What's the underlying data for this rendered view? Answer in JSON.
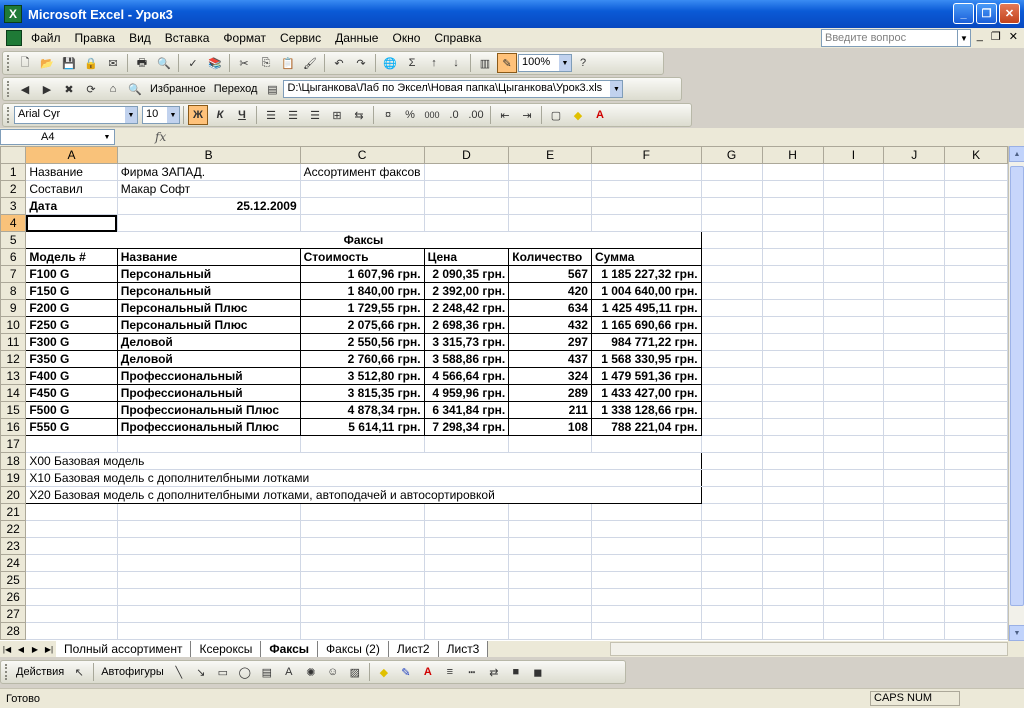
{
  "window": {
    "title": "Microsoft Excel - Урок3",
    "minimize": "_",
    "maximize": "❐",
    "close": "✕"
  },
  "menu": {
    "items": [
      "Файл",
      "Правка",
      "Вид",
      "Вставка",
      "Формат",
      "Сервис",
      "Данные",
      "Окно",
      "Справка"
    ],
    "ask_placeholder": "Введите вопрос",
    "doc_min": "_",
    "doc_restore": "❐",
    "doc_close": "✕"
  },
  "toolbar": {
    "zoom": "100%",
    "favorites_label": "Избранное",
    "goto_label": "Переход",
    "path": "D:\\Цыганкова\\Лаб по Эксел\\Новая папка\\Цыганкова\\Урок3.xls",
    "font_name": "Arial Cyr",
    "font_size": "10",
    "bold_label": "Ж",
    "italic_label": "К",
    "underline_label": "Ч",
    "percent_label": "%",
    "thousands_label": "000"
  },
  "formula_bar": {
    "cell_ref": "A4",
    "fx_label": "fx",
    "content": ""
  },
  "columns": [
    "A",
    "B",
    "C",
    "D",
    "E",
    "F",
    "G",
    "H",
    "I",
    "J",
    "K"
  ],
  "selected_cell": "A4",
  "rows": [
    {
      "n": "1",
      "cells": [
        "Название",
        "Фирма ЗАПАД.",
        "Ассортимент факсов",
        "",
        "",
        ""
      ]
    },
    {
      "n": "2",
      "cells": [
        "Составил",
        "Макар Софт",
        "",
        "",
        "",
        ""
      ]
    },
    {
      "n": "3",
      "cells": [
        "Дата",
        "25.12.2009",
        "",
        "",
        "",
        ""
      ]
    },
    {
      "n": "4",
      "cells": [
        "",
        "",
        "",
        "",
        "",
        ""
      ]
    },
    {
      "n": "5",
      "merged": "Факсы"
    },
    {
      "n": "6",
      "cells": [
        "Модель #",
        "Название",
        "Стоимость",
        "Цена",
        "Количество",
        "Сумма"
      ]
    },
    {
      "n": "7",
      "cells": [
        "F100 G",
        "Персональный",
        "1 607,96 грн.",
        "2 090,35 грн.",
        "567",
        "1 185 227,32 грн."
      ]
    },
    {
      "n": "8",
      "cells": [
        "F150 G",
        "Персональный",
        "1 840,00 грн.",
        "2 392,00 грн.",
        "420",
        "1 004 640,00 грн."
      ]
    },
    {
      "n": "9",
      "cells": [
        "F200 G",
        "Персональный Плюс",
        "1 729,55 грн.",
        "2 248,42 грн.",
        "634",
        "1 425 495,11 грн."
      ]
    },
    {
      "n": "10",
      "cells": [
        "F250 G",
        "Персональный Плюс",
        "2 075,66 грн.",
        "2 698,36 грн.",
        "432",
        "1 165 690,66 грн."
      ]
    },
    {
      "n": "11",
      "cells": [
        "F300 G",
        "Деловой",
        "2 550,56 грн.",
        "3 315,73 грн.",
        "297",
        "984 771,22 грн."
      ]
    },
    {
      "n": "12",
      "cells": [
        "F350 G",
        "Деловой",
        "2 760,66 грн.",
        "3 588,86 грн.",
        "437",
        "1 568 330,95 грн."
      ]
    },
    {
      "n": "13",
      "cells": [
        "F400 G",
        "Профессиональный",
        "3 512,80 грн.",
        "4 566,64 грн.",
        "324",
        "1 479 591,36 грн."
      ]
    },
    {
      "n": "14",
      "cells": [
        "F450 G",
        "Профессиональный",
        "3 815,35 грн.",
        "4 959,96 грн.",
        "289",
        "1 433 427,00 грн."
      ]
    },
    {
      "n": "15",
      "cells": [
        "F500 G",
        "Профессиональный Плюс",
        "4 878,34 грн.",
        "6 341,84 грн.",
        "211",
        "1 338 128,66 грн."
      ]
    },
    {
      "n": "16",
      "cells": [
        "F550 G",
        "Профессиональный Плюс",
        "5 614,11 грн.",
        "7 298,34 грн.",
        "108",
        "788 221,04 грн."
      ]
    },
    {
      "n": "17",
      "cells": [
        "",
        "",
        "",
        "",
        "",
        ""
      ]
    },
    {
      "n": "18",
      "note": "X00 Базовая модель"
    },
    {
      "n": "19",
      "note": "X10 Базовая модель с дополнителбными лотками"
    },
    {
      "n": "20",
      "note": "X20 Базовая модель с дополнителбными лотками, автоподачей и автосортировкой"
    },
    {
      "n": "21",
      "cells": [
        "",
        "",
        "",
        "",
        "",
        ""
      ]
    },
    {
      "n": "22",
      "cells": [
        "",
        "",
        "",
        "",
        "",
        ""
      ]
    },
    {
      "n": "23",
      "cells": [
        "",
        "",
        "",
        "",
        "",
        ""
      ]
    },
    {
      "n": "24",
      "cells": [
        "",
        "",
        "",
        "",
        "",
        ""
      ]
    },
    {
      "n": "25",
      "cells": [
        "",
        "",
        "",
        "",
        "",
        ""
      ]
    },
    {
      "n": "26",
      "cells": [
        "",
        "",
        "",
        "",
        "",
        ""
      ]
    },
    {
      "n": "27",
      "cells": [
        "",
        "",
        "",
        "",
        "",
        ""
      ]
    },
    {
      "n": "28",
      "cells": [
        "",
        "",
        "",
        "",
        "",
        ""
      ]
    }
  ],
  "sheet_tabs": [
    "Полный ассортимент",
    "Ксерокcы",
    "Факсы",
    "Факсы (2)",
    "Лист2",
    "Лист3"
  ],
  "active_tab": 2,
  "drawing": {
    "actions_label": "Действия",
    "autoshapes_label": "Автофигуры"
  },
  "status": {
    "ready": "Готово",
    "caps": "CAPS NUM"
  },
  "colors": {
    "title_bar": "#0a5ad6",
    "selection_header": "#f9c27a",
    "grid_line": "#d0d7e5"
  }
}
